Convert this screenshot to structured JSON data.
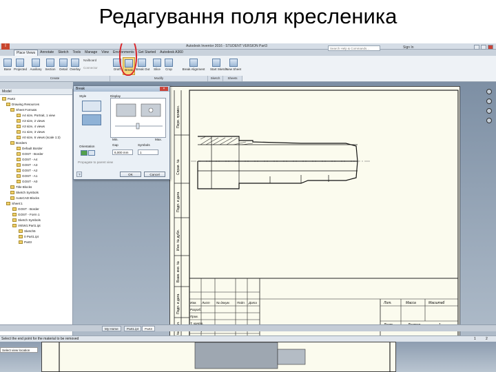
{
  "slide": {
    "title": "Редагування поля кресленика"
  },
  "app": {
    "window_title": "Autodesk Inventor 2016 - STUDENT VERSION   Part3",
    "logo": "I",
    "tabs": [
      "Place Views",
      "Annotate",
      "Sketch",
      "Tools",
      "Manage",
      "View",
      "Environments",
      "Get Started",
      "Autodesk A360"
    ],
    "search_placeholder": "Search Help & Commands...",
    "signin": "Sign In",
    "accent_color": "#f6d77e",
    "annotation_color": "#d9252a"
  },
  "ribbon": {
    "create_buttons": [
      "Base",
      "Projected",
      "Auxiliary",
      "Section",
      "Detail",
      "Overlay"
    ],
    "small_buttons": [
      "Nailboard",
      "Connector"
    ],
    "modify_buttons": [
      "Draft",
      "Break",
      "Break Out",
      "Slice",
      "Crop",
      "Break Alignment"
    ],
    "sketch_buttons": [
      "Start Sketch"
    ],
    "sheet_buttons": [
      "New Sheet"
    ],
    "groups": [
      "Create",
      "Modify",
      "Sketch",
      "Sheets"
    ]
  },
  "browser": {
    "title": "Model",
    "items": [
      "Part3",
      "Drawing Resources",
      "Sheet Formats",
      "A4 size, Portrait, 1 view",
      "A3 size, 2 views",
      "A3 size, 4 views",
      "A1 size, 3 views",
      "A0 size, 6 views (scale 1:2)",
      "Borders",
      "Default Border",
      "GOST - Border",
      "GOST - A4",
      "GOST - A3",
      "GOST - A2",
      "GOST - A1",
      "GOST - A0",
      "Title Blocks",
      "Sketch Symbols",
      "AutoCAD Blocks",
      "Sheet:1",
      "GOST - Border",
      "GOST - Form 1",
      "Sketch Symbols",
      "VIEW1:Part1.ipt",
      "Sketch5",
      "0 Part1.ipt",
      "Part3"
    ]
  },
  "dialog": {
    "title": "Break",
    "style_label": "Style",
    "display_label": "Display",
    "min_label": "Min.",
    "max_label": "Max.",
    "orientation_label": "Orientation",
    "gap_label": "Gap",
    "gap_value": "6,000 mm",
    "symbols_label": "Symbols",
    "symbols_value": "1",
    "propagate_label": "Propagate to parent view",
    "ok_label": "OK",
    "cancel_label": "Cancel"
  },
  "titleblock": {
    "labels": [
      "Лит.",
      "Масса",
      "Масштаб",
      "Лист",
      "Листов",
      "Изм.",
      "Лист",
      "№ докум.",
      "Подп.",
      "Дата",
      "Разраб.",
      "Пров.",
      "Т. контр.",
      "Н. контр.",
      "Утв.",
      "Копировал",
      "Формат"
    ],
    "sheet_count": "1",
    "frame_side_labels": [
      "Перв. примен.",
      "Справ. №",
      "Подп. и дата",
      "Инв. № дубл.",
      "Взам. инв. №",
      "Подп. и дата",
      "Инв. № подл."
    ]
  },
  "doc_tabs": [
    "My Home",
    "Part1.ipt",
    "Part3"
  ],
  "status": {
    "message": "Select the end point for the material to be removed",
    "page_left": "1",
    "page_right": "2",
    "view_location": "Select view location"
  }
}
